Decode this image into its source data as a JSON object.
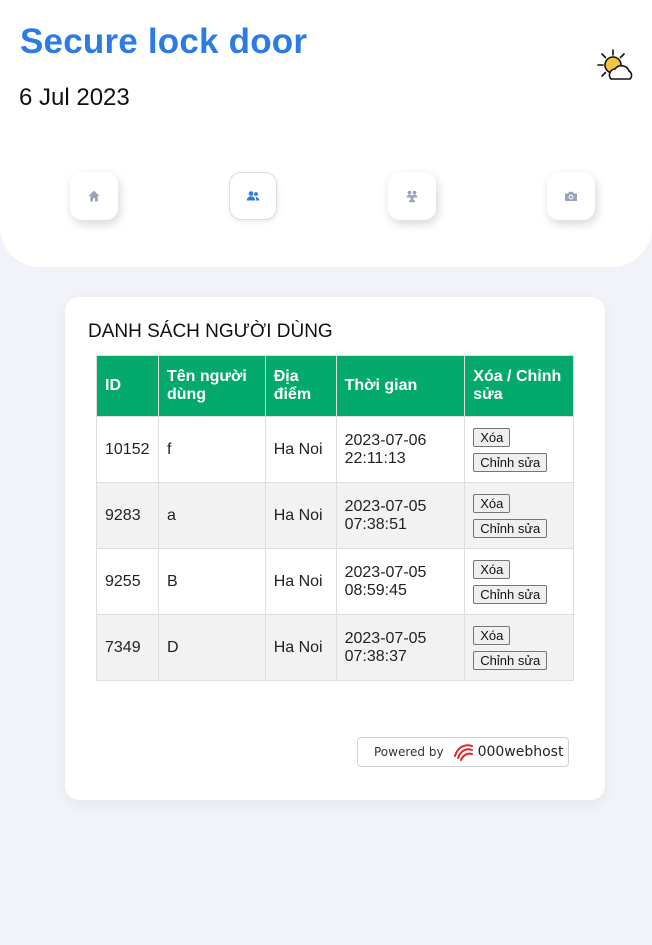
{
  "header": {
    "title": "Secure lock door",
    "date": "6 Jul 2023",
    "weather_icon": "partly-sunny-icon"
  },
  "nav": [
    {
      "name": "home",
      "icon": "home-icon",
      "active": false
    },
    {
      "name": "users",
      "icon": "users-icon",
      "active": true
    },
    {
      "name": "group",
      "icon": "group-icon",
      "active": false
    },
    {
      "name": "camera",
      "icon": "camera-icon",
      "active": false
    }
  ],
  "users_card": {
    "title": "DANH SÁCH NGƯỜI DÙNG",
    "columns": [
      "ID",
      "Tên người dùng",
      "Địa điểm",
      "Thời gian",
      "Xóa / Chỉnh sửa"
    ],
    "rows": [
      {
        "id": "10152",
        "name": "f",
        "location": "Ha Noi",
        "time": "2023-07-06 22:11:13"
      },
      {
        "id": "9283",
        "name": "a",
        "location": "Ha Noi",
        "time": "2023-07-05 07:38:51"
      },
      {
        "id": "9255",
        "name": "B",
        "location": "Ha Noi",
        "time": "2023-07-05 08:59:45"
      },
      {
        "id": "7349",
        "name": "D",
        "location": "Ha Noi",
        "time": "2023-07-05 07:38:37"
      }
    ],
    "delete_label": "Xóa",
    "edit_label": "Chỉnh sửa"
  },
  "footer": {
    "powered_by": "Powered by",
    "brand": "000webhost"
  },
  "colors": {
    "title_blue": "#2b7be4",
    "table_header_green": "#04aa6d",
    "background": "#f1f3f8"
  }
}
